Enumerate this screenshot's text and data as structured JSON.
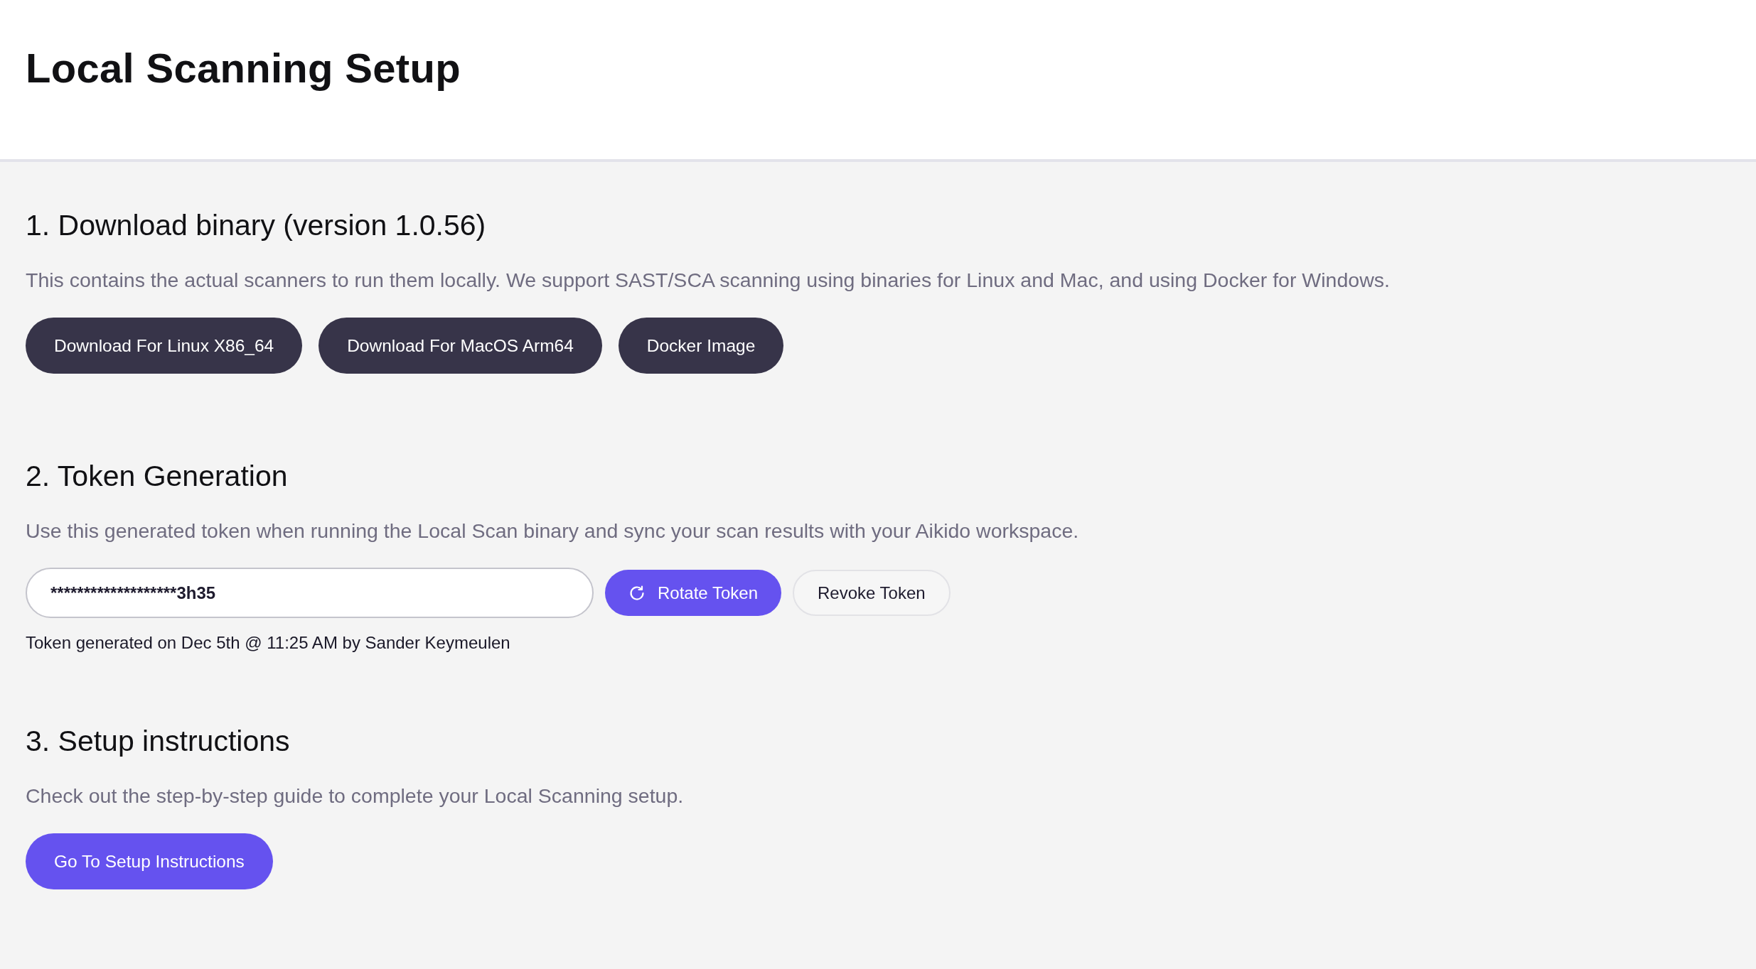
{
  "header": {
    "title": "Local Scanning Setup"
  },
  "sections": [
    {
      "kind": "downloads",
      "heading": "1. Download binary (version 1.0.56)",
      "description": "This contains the actual scanners to run them locally. We support SAST/SCA scanning using binaries for Linux and Mac, and using Docker for Windows.",
      "download_buttons": [
        "Download For Linux X86_64",
        "Download For MacOS Arm64",
        "Docker Image"
      ]
    },
    {
      "kind": "token",
      "heading": "2. Token Generation",
      "description": "Use this generated token when running the Local Scan binary and sync your scan results with your Aikido workspace.",
      "token_field": {
        "value": "*******************3h35"
      },
      "rotate_button": {
        "label": "Rotate Token"
      },
      "revoke_button": {
        "label": "Revoke Token"
      },
      "token_note": "Token generated on Dec 5th @ 11:25 AM by Sander Keymeulen"
    },
    {
      "kind": "guide",
      "heading": "3. Setup instructions",
      "description": "Check out the step-by-step guide to complete your Local Scanning setup.",
      "guide_button": {
        "label": "Go To Setup Instructions"
      }
    }
  ]
}
